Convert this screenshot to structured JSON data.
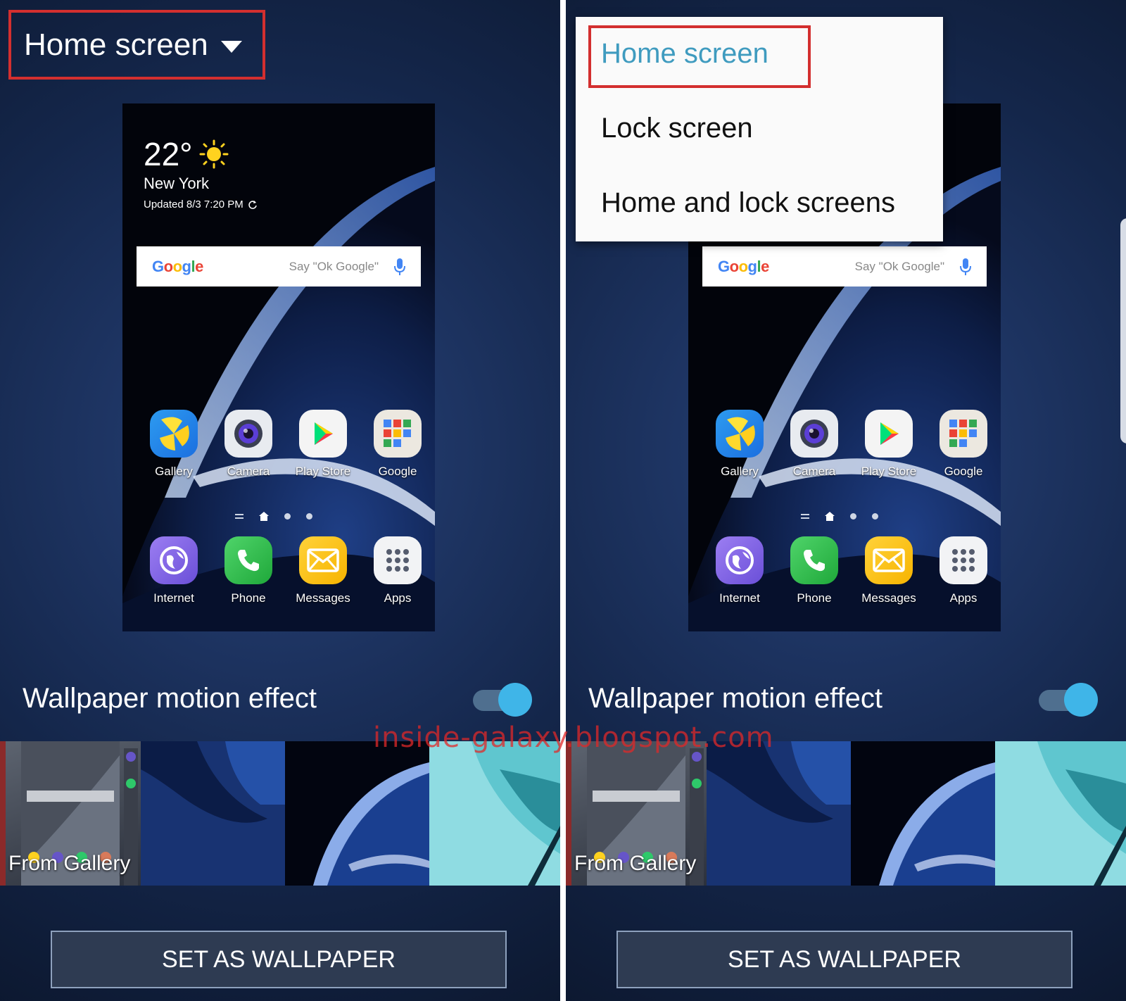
{
  "colors": {
    "highlight": "#d32f2f",
    "selected_item": "#3f9bbf",
    "toggle_on": "#3fb5e8",
    "watermark": "#e02828"
  },
  "header": {
    "title": "Home screen",
    "caret_icon": "caret-down-icon"
  },
  "weather": {
    "temperature": "22°",
    "city": "New York",
    "updated": "Updated 8/3 7:20 PM",
    "icon": "sun-icon",
    "refresh_icon": "refresh-icon"
  },
  "search": {
    "logo": "Google",
    "hint": "Say \"Ok Google\"",
    "icon": "mic-icon"
  },
  "apps_row1": [
    {
      "label": "Gallery",
      "icon": "gallery-icon"
    },
    {
      "label": "Camera",
      "icon": "camera-icon"
    },
    {
      "label": "Play Store",
      "icon": "play-store-icon"
    },
    {
      "label": "Google",
      "icon": "google-folder-icon"
    }
  ],
  "apps_row2": [
    {
      "label": "Internet",
      "icon": "internet-icon"
    },
    {
      "label": "Phone",
      "icon": "phone-icon"
    },
    {
      "label": "Messages",
      "icon": "messages-icon"
    },
    {
      "label": "Apps",
      "icon": "apps-icon"
    }
  ],
  "motion": {
    "label": "Wallpaper motion effect",
    "enabled": true
  },
  "gallery": {
    "from_label": "From Gallery"
  },
  "set_button": "SET AS WALLPAPER",
  "menu": {
    "items": [
      "Home screen",
      "Lock screen",
      "Home and lock screens"
    ],
    "selected": "Home screen"
  },
  "watermark": "inside-galaxy.blogspot.com"
}
